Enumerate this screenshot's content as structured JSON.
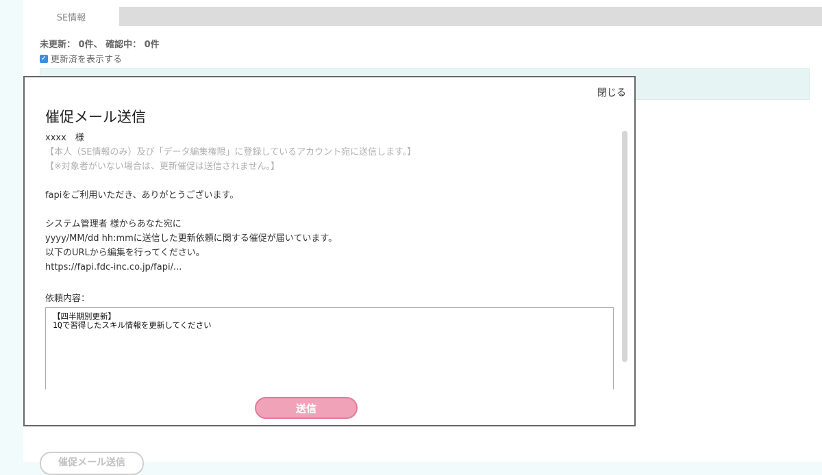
{
  "tabs": [
    {
      "label": "SE情報"
    }
  ],
  "summary": {
    "text": "未更新： 0件、 確認中： 0件"
  },
  "show_updated": {
    "label": "更新済を表示する",
    "checked": true
  },
  "bottom_button": {
    "label": "催促メール送信"
  },
  "modal": {
    "close_label": "閉じる",
    "title": "催促メール送信",
    "lines": {
      "recipient": "xxxx　様",
      "note1": "【本人（SE情報のみ）及び「データ編集権限」に登録しているアカウント宛に送信します。】",
      "note2": "【※対象者がいない場合は、更新催促は送信されません。】",
      "thanks": "fapiをご利用いただき、ありがとうございます。",
      "from": "システム管理者 様からあなた宛に",
      "sent": "yyyy/MM/dd hh:mmに送信した更新依頼に関する催促が届いています。",
      "instruction": "以下のURLから編集を行ってください。",
      "url": "https://fapi.fdc-inc.co.jp/fapi/..."
    },
    "request_label": "依頼内容：",
    "request_lines": [
      "【四半期別更新】",
      "1Qで習得したスキル情報を更新してください"
    ],
    "send_label": "送信"
  },
  "colors": {
    "accent_pink": "#f0a3b8",
    "checkbox_blue": "#3b8ee0",
    "table_header": "#e6f4f4"
  }
}
